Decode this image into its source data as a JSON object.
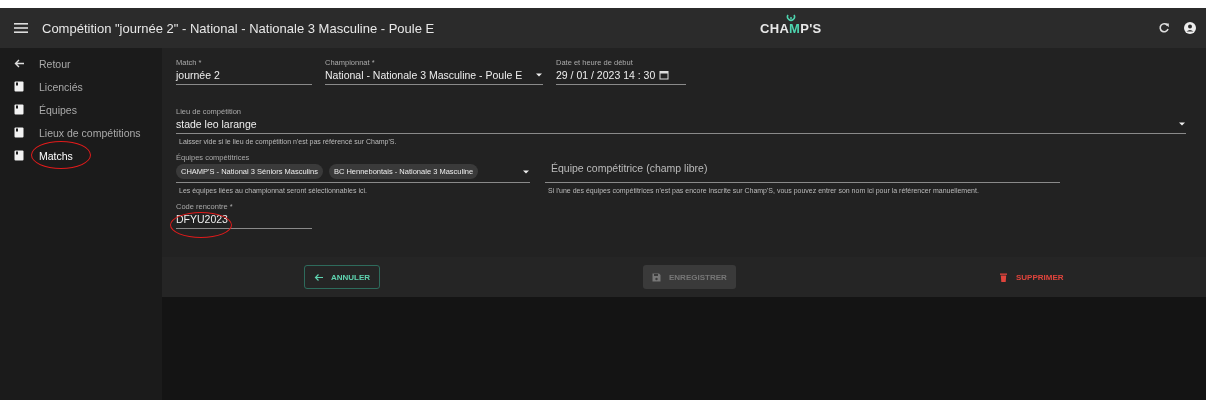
{
  "header": {
    "title": "Compétition \"journée 2\" - National - Nationale 3 Masculine - Poule E",
    "logo_parts": [
      {
        "text": "CHA",
        "accent": false
      },
      {
        "text": "M",
        "accent": true
      },
      {
        "text": "P'S",
        "accent": false
      }
    ]
  },
  "sidebar": {
    "back": "Retour",
    "items": [
      {
        "label": "Licenciés",
        "selected": false,
        "annotated": false
      },
      {
        "label": "Équipes",
        "selected": false,
        "annotated": false
      },
      {
        "label": "Lieux de compétitions",
        "selected": false,
        "annotated": false
      },
      {
        "label": "Matchs",
        "selected": true,
        "annotated": true
      }
    ]
  },
  "form": {
    "match": {
      "label": "Match *",
      "value": "journée 2"
    },
    "championnat": {
      "label": "Championnat *",
      "value": "National - Nationale 3 Masculine - Poule E"
    },
    "date": {
      "label": "Date et heure de début",
      "value": "29 / 01 / 2023  14 : 30"
    },
    "lieu": {
      "label": "Lieu de compétition",
      "value": "stade leo larange",
      "hint": "Laisser vide si le lieu de compétition n'est pas référencé sur Champ'S."
    },
    "equipes": {
      "label": "Équipes compétitrices",
      "chips": [
        "CHAMP'S - National 3 Séniors Masculins",
        "BC Hennebontais - Nationale 3 Masculine"
      ],
      "hint": "Les équipes liées au championnat seront sélectionnables ici."
    },
    "equipe_libre": {
      "placeholder": "Équipe compétitrice (champ libre)",
      "hint": "Si l'une des équipes compétitrices n'est pas encore inscrite sur Champ'S, vous pouvez entrer son nom ici pour la référencer manuellement."
    },
    "code": {
      "label": "Code rencontre *",
      "value": "DFYU2023",
      "annotated": true
    }
  },
  "actions": [
    {
      "kind": "cancel",
      "label": "ANNULER",
      "disabled": false
    },
    {
      "kind": "save",
      "label": "ENREGISTRER",
      "disabled": true
    },
    {
      "kind": "delete",
      "label": "SUPPRIMER",
      "disabled": false
    }
  ]
}
